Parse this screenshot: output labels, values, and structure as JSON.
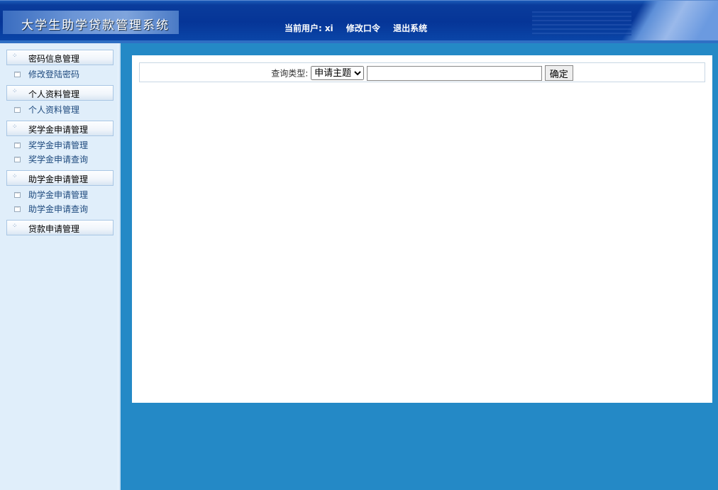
{
  "header": {
    "title": "大学生助学贷款管理系统",
    "current_user_label": "当前用户:",
    "current_user": "xi",
    "change_password": "修改口令",
    "logout": "退出系统"
  },
  "sidebar": {
    "groups": [
      {
        "label": "密码信息管理",
        "items": [
          "修改登陆密码"
        ]
      },
      {
        "label": "个人资料管理",
        "items": [
          "个人资料管理"
        ]
      },
      {
        "label": "奖学金申请管理",
        "items": [
          "奖学金申请管理",
          "奖学金申请查询"
        ]
      },
      {
        "label": "助学金申请管理",
        "items": [
          "助学金申请管理",
          "助学金申请查询"
        ]
      },
      {
        "label": "贷款申请管理",
        "items": []
      }
    ]
  },
  "query": {
    "label": "查询类型:",
    "select_value": "申请主题",
    "input_value": "",
    "submit": "确定"
  }
}
